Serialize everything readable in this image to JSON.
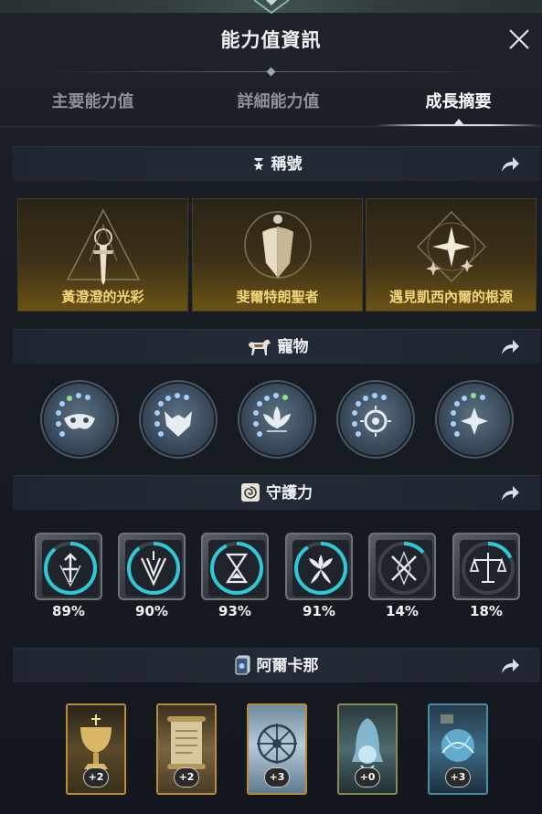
{
  "header": {
    "title": "能力值資訊"
  },
  "tabs": [
    {
      "label": "主要能力值",
      "active": false
    },
    {
      "label": "詳細能力值",
      "active": false
    },
    {
      "label": "成長摘要",
      "active": true
    }
  ],
  "sections": {
    "titles": {
      "heading": "稱號",
      "items": [
        {
          "label": "黃澄澄的光彩",
          "icon": "sword-triangle-emblem"
        },
        {
          "label": "斐爾特朗聖者",
          "icon": "shield-circle-emblem"
        },
        {
          "label": "遇見凱西內爾的根源",
          "icon": "star-diamond-emblem"
        }
      ]
    },
    "pets": {
      "heading": "寵物",
      "items": [
        {
          "icon": "mask-pet-icon"
        },
        {
          "icon": "wolf-pet-icon"
        },
        {
          "icon": "lotus-pet-icon"
        },
        {
          "icon": "eye-pet-icon"
        },
        {
          "icon": "star-pet-icon"
        }
      ]
    },
    "guardian": {
      "heading": "守護力",
      "items": [
        {
          "percent": "89%",
          "progress": 0.89,
          "icon": "sword-shield-icon"
        },
        {
          "percent": "90%",
          "progress": 0.9,
          "icon": "wing-blades-icon"
        },
        {
          "percent": "93%",
          "progress": 0.93,
          "icon": "hourglass-icon"
        },
        {
          "percent": "91%",
          "progress": 0.91,
          "icon": "flower-icon"
        },
        {
          "percent": "14%",
          "progress": 0.14,
          "icon": "crossed-swords-icon"
        },
        {
          "percent": "18%",
          "progress": 0.18,
          "icon": "scales-icon"
        }
      ]
    },
    "arcana": {
      "heading": "阿爾卡那",
      "items": [
        {
          "level": "+2",
          "icon": "chalice-card",
          "frame": "#c0903c"
        },
        {
          "level": "+2",
          "icon": "scroll-card",
          "frame": "#c0903c"
        },
        {
          "level": "+3",
          "icon": "wheel-card",
          "frame": "#b98c3a"
        },
        {
          "level": "+0",
          "icon": "bell-card",
          "frame": "#8c8a52"
        },
        {
          "level": "+3",
          "icon": "orb-card",
          "frame": "#4b8aa0"
        }
      ]
    }
  },
  "colors": {
    "accent_teal": "#2ec8d8",
    "title_gold": "#f3d77a"
  }
}
